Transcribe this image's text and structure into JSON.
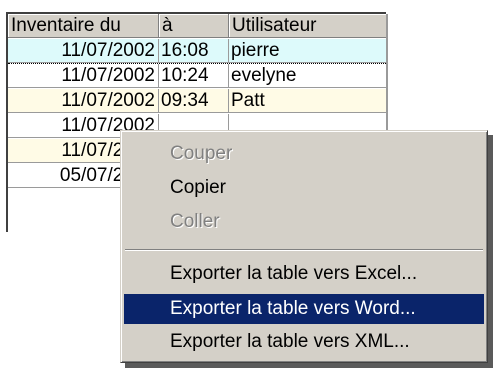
{
  "table": {
    "columns": [
      "Inventaire du",
      "à",
      "Utilisateur"
    ],
    "rows": [
      [
        "11/07/2002",
        "16:08",
        "pierre"
      ],
      [
        "11/07/2002",
        "10:24",
        "evelyne"
      ],
      [
        "11/07/2002",
        "09:34",
        "Patt"
      ],
      [
        "11/07/2002",
        "",
        ""
      ],
      [
        "11/07/2002",
        "",
        ""
      ],
      [
        "05/07/2002",
        "",
        ""
      ]
    ],
    "colors": {
      "header_bg": "#d4d0c8",
      "selected_row_bg": "#ddfafb",
      "alt_row_bg": "#fffbe6"
    }
  },
  "context_menu": {
    "items": [
      {
        "label": "Couper",
        "enabled": false
      },
      {
        "label": "Copier",
        "enabled": true
      },
      {
        "label": "Coller",
        "enabled": false
      },
      {
        "label": "Exporter la table vers Excel...",
        "enabled": true
      },
      {
        "label": "Exporter la table vers Word...",
        "enabled": true,
        "highlighted": true
      },
      {
        "label": "Exporter la table vers XML...",
        "enabled": true
      }
    ],
    "colors": {
      "highlight_bg": "#0a246a",
      "highlight_fg": "#ffffff",
      "disabled_fg": "#808080"
    }
  }
}
